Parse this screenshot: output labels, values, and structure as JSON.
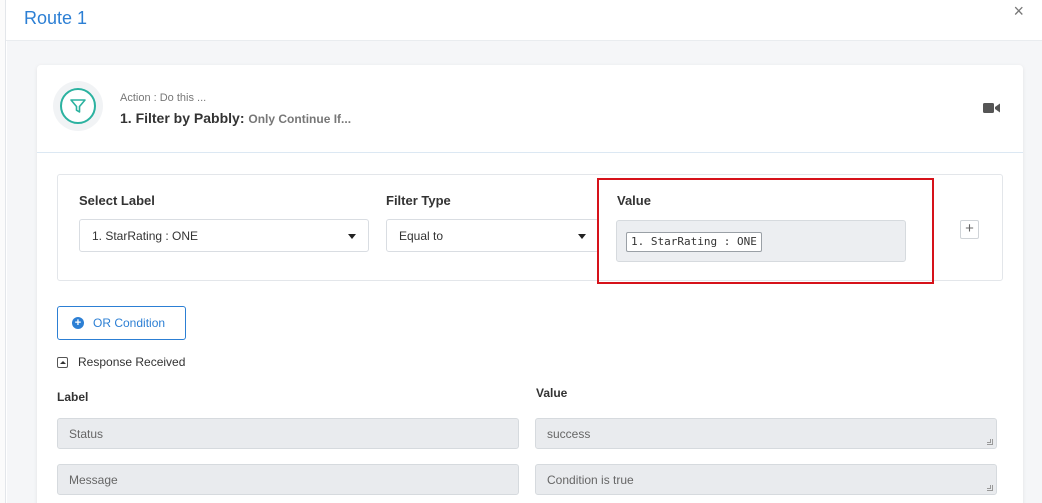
{
  "modal": {
    "title": "Route 1",
    "close_label": "×"
  },
  "action": {
    "subtitle": "Action : Do this ...",
    "title": "1. Filter by Pabbly:",
    "tag": "Only Continue If..."
  },
  "filter": {
    "select_label_header": "Select Label",
    "select_label_value": "1. StarRating : ONE",
    "filter_type_header": "Filter Type",
    "filter_type_value": "Equal to",
    "value_header": "Value",
    "value_chip": "1. StarRating : ONE",
    "add_label": "+"
  },
  "or_condition": {
    "label": "OR Condition",
    "icon": "+"
  },
  "response": {
    "toggle_label": "Response Received",
    "label_header": "Label",
    "value_header": "Value",
    "rows": [
      {
        "label": "Status",
        "value": "success"
      },
      {
        "label": "Message",
        "value": "Condition is true"
      }
    ]
  },
  "colors": {
    "accent": "#2c7fd4",
    "filter_icon": "#2bb2a0",
    "highlight": "#d6121a"
  }
}
